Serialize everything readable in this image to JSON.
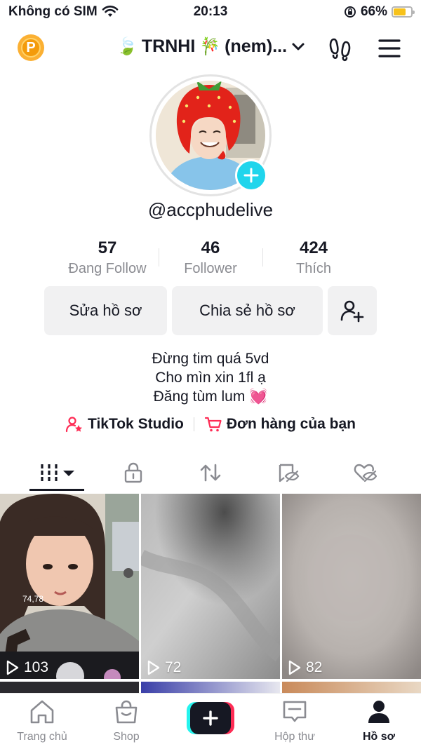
{
  "status_bar": {
    "carrier": "Không có SIM",
    "time": "20:13",
    "battery_percent": "66%",
    "battery_level": 0.66,
    "wifi_icon": "wifi-icon",
    "orientation_icon": "orientation-lock-icon"
  },
  "header": {
    "coin_label": "P",
    "title": "TRNHI",
    "title_suffix": "(nem)...",
    "leaf_emoji": "🍃",
    "bamboo_emoji": "🎋"
  },
  "profile": {
    "username": "@accphudelive",
    "stats": [
      {
        "value": "57",
        "label": "Đang Follow"
      },
      {
        "value": "46",
        "label": "Follower"
      },
      {
        "value": "424",
        "label": "Thích"
      }
    ],
    "edit_button": "Sửa hồ sơ",
    "share_button": "Chia sẻ hồ sơ",
    "bio_lines": [
      "Đừng tim quá 5vd",
      "Cho mìn xin 1fl ạ",
      "Đăng tùm lum 💓"
    ],
    "studio_link": "TikTok Studio",
    "orders_link": "Đơn hàng của bạn"
  },
  "videos": [
    {
      "views": "103",
      "overlay_text": "74,78"
    },
    {
      "views": "72"
    },
    {
      "views": "82"
    }
  ],
  "bottom_nav": {
    "home": "Trang chủ",
    "shop": "Shop",
    "inbox": "Hộp thư",
    "profile": "Hồ sơ"
  },
  "colors": {
    "accent_pink": "#fe2c55",
    "accent_cyan": "#25f4ee",
    "text_primary": "#161823",
    "text_secondary": "#8a8b91",
    "button_bg": "#f1f1f2"
  }
}
